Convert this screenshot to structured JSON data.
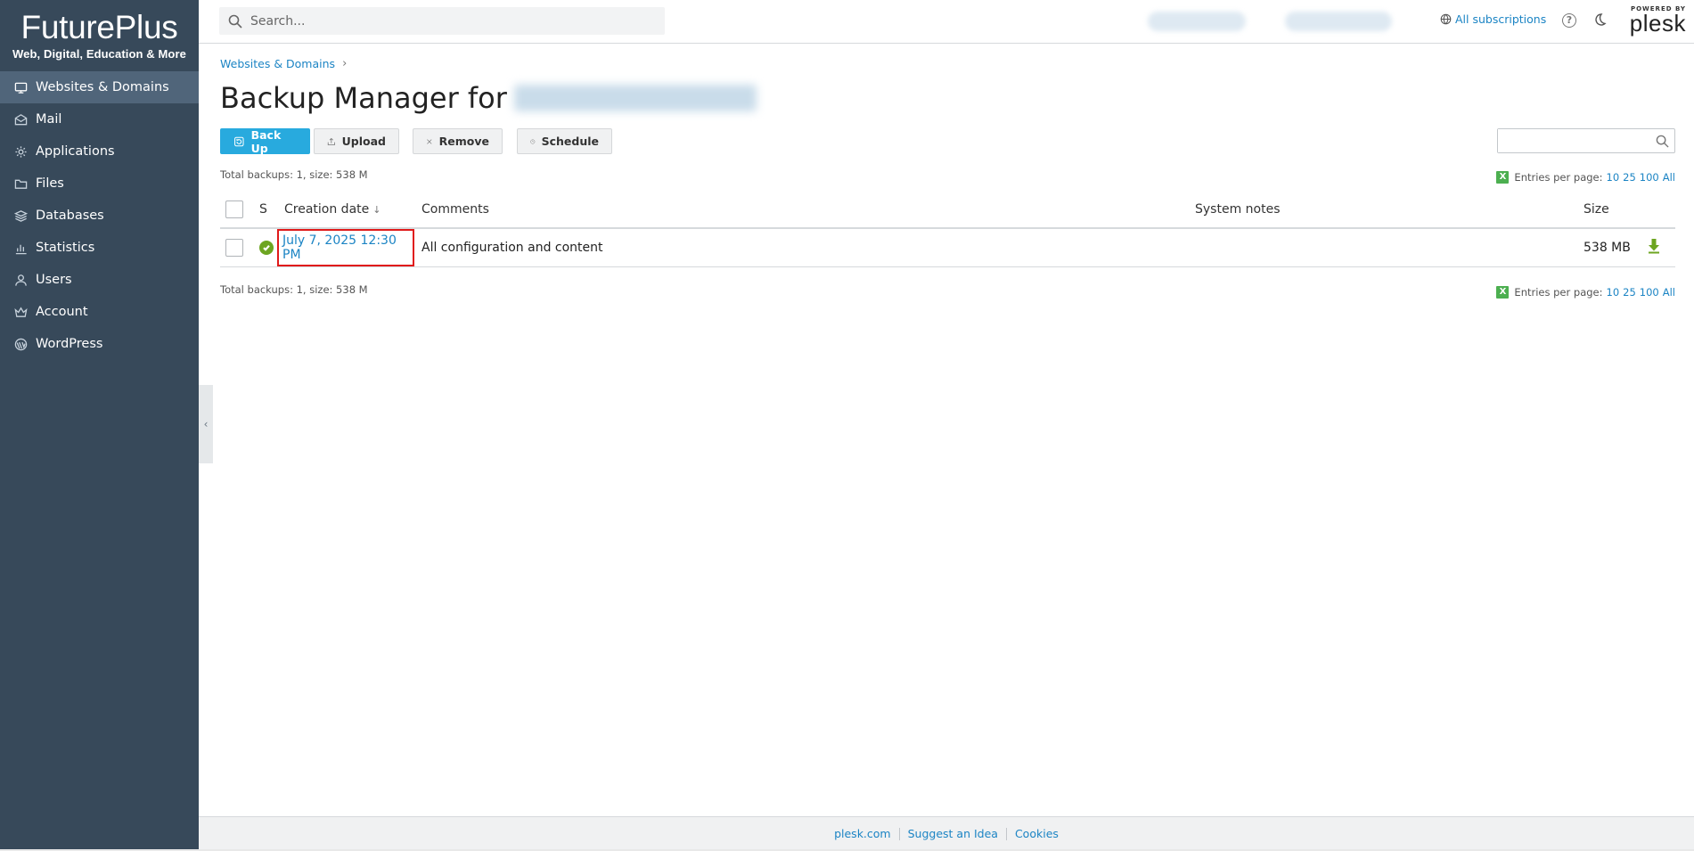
{
  "brand": {
    "title": "FuturePlus",
    "tagline": "Web, Digital, Education & More"
  },
  "sidebar": {
    "items": [
      {
        "label": "Websites & Domains",
        "icon": "monitor-icon",
        "active": true
      },
      {
        "label": "Mail",
        "icon": "mail-icon"
      },
      {
        "label": "Applications",
        "icon": "gear-icon"
      },
      {
        "label": "Files",
        "icon": "folder-icon"
      },
      {
        "label": "Databases",
        "icon": "layers-icon"
      },
      {
        "label": "Statistics",
        "icon": "bar-chart-icon"
      },
      {
        "label": "Users",
        "icon": "user-icon"
      },
      {
        "label": "Account",
        "icon": "crown-icon"
      },
      {
        "label": "WordPress",
        "icon": "wordpress-icon"
      }
    ]
  },
  "topbar": {
    "search_placeholder": "Search...",
    "subscriptions_label": "All subscriptions",
    "help_glyph": "?",
    "powered_by": "POWERED BY",
    "plesk": "plesk"
  },
  "breadcrumb": {
    "item": "Websites & Domains",
    "separator": "›"
  },
  "page": {
    "title": "Backup Manager for"
  },
  "toolbar": {
    "backup_label": "Back Up",
    "upload_label": "Upload",
    "remove_label": "Remove",
    "schedule_label": "Schedule"
  },
  "summary": {
    "total_text": "Total backups: 1, size: 538 M",
    "entries_label": "Entries per page:",
    "xls_glyph": "X",
    "page_sizes": [
      "10",
      "25",
      "100",
      "All"
    ]
  },
  "table": {
    "headers": {
      "status": "S",
      "creation_date": "Creation date",
      "sort_indicator": "↓",
      "comments": "Comments",
      "system_notes": "System notes",
      "size": "Size"
    },
    "rows": [
      {
        "status": "ok",
        "creation_date": "July 7, 2025 12:30 PM",
        "comments": "All configuration and content",
        "system_notes": "",
        "size": "538 MB"
      }
    ]
  },
  "footer": {
    "links": [
      "plesk.com",
      "Suggest an Idea",
      "Cookies"
    ]
  },
  "colors": {
    "sidebar_bg": "#37495a",
    "sidebar_active": "#50657a",
    "primary_button": "#28aade",
    "link": "#1b84c4",
    "status_ok": "#6da521",
    "highlight_border": "#e01a1a"
  }
}
